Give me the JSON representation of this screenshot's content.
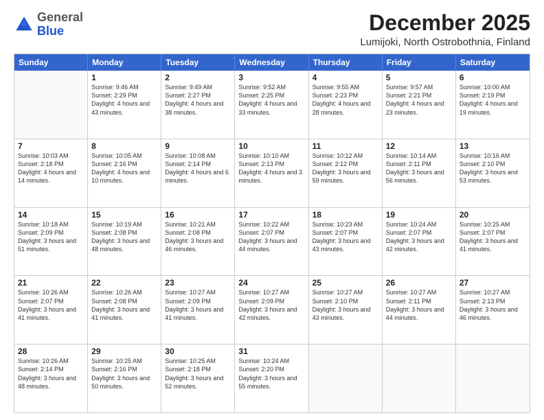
{
  "logo": {
    "general": "General",
    "blue": "Blue"
  },
  "header": {
    "title": "December 2025",
    "subtitle": "Lumijoki, North Ostrobothnia, Finland"
  },
  "weekdays": [
    "Sunday",
    "Monday",
    "Tuesday",
    "Wednesday",
    "Thursday",
    "Friday",
    "Saturday"
  ],
  "weeks": [
    [
      {
        "day": "",
        "sunrise": "",
        "sunset": "",
        "daylight": ""
      },
      {
        "day": "1",
        "sunrise": "Sunrise: 9:46 AM",
        "sunset": "Sunset: 2:29 PM",
        "daylight": "Daylight: 4 hours and 43 minutes."
      },
      {
        "day": "2",
        "sunrise": "Sunrise: 9:49 AM",
        "sunset": "Sunset: 2:27 PM",
        "daylight": "Daylight: 4 hours and 38 minutes."
      },
      {
        "day": "3",
        "sunrise": "Sunrise: 9:52 AM",
        "sunset": "Sunset: 2:25 PM",
        "daylight": "Daylight: 4 hours and 33 minutes."
      },
      {
        "day": "4",
        "sunrise": "Sunrise: 9:55 AM",
        "sunset": "Sunset: 2:23 PM",
        "daylight": "Daylight: 4 hours and 28 minutes."
      },
      {
        "day": "5",
        "sunrise": "Sunrise: 9:57 AM",
        "sunset": "Sunset: 2:21 PM",
        "daylight": "Daylight: 4 hours and 23 minutes."
      },
      {
        "day": "6",
        "sunrise": "Sunrise: 10:00 AM",
        "sunset": "Sunset: 2:19 PM",
        "daylight": "Daylight: 4 hours and 19 minutes."
      }
    ],
    [
      {
        "day": "7",
        "sunrise": "Sunrise: 10:03 AM",
        "sunset": "Sunset: 2:18 PM",
        "daylight": "Daylight: 4 hours and 14 minutes."
      },
      {
        "day": "8",
        "sunrise": "Sunrise: 10:05 AM",
        "sunset": "Sunset: 2:16 PM",
        "daylight": "Daylight: 4 hours and 10 minutes."
      },
      {
        "day": "9",
        "sunrise": "Sunrise: 10:08 AM",
        "sunset": "Sunset: 2:14 PM",
        "daylight": "Daylight: 4 hours and 6 minutes."
      },
      {
        "day": "10",
        "sunrise": "Sunrise: 10:10 AM",
        "sunset": "Sunset: 2:13 PM",
        "daylight": "Daylight: 4 hours and 3 minutes."
      },
      {
        "day": "11",
        "sunrise": "Sunrise: 10:12 AM",
        "sunset": "Sunset: 2:12 PM",
        "daylight": "Daylight: 3 hours and 59 minutes."
      },
      {
        "day": "12",
        "sunrise": "Sunrise: 10:14 AM",
        "sunset": "Sunset: 2:11 PM",
        "daylight": "Daylight: 3 hours and 56 minutes."
      },
      {
        "day": "13",
        "sunrise": "Sunrise: 10:16 AM",
        "sunset": "Sunset: 2:10 PM",
        "daylight": "Daylight: 3 hours and 53 minutes."
      }
    ],
    [
      {
        "day": "14",
        "sunrise": "Sunrise: 10:18 AM",
        "sunset": "Sunset: 2:09 PM",
        "daylight": "Daylight: 3 hours and 51 minutes."
      },
      {
        "day": "15",
        "sunrise": "Sunrise: 10:19 AM",
        "sunset": "Sunset: 2:08 PM",
        "daylight": "Daylight: 3 hours and 48 minutes."
      },
      {
        "day": "16",
        "sunrise": "Sunrise: 10:21 AM",
        "sunset": "Sunset: 2:08 PM",
        "daylight": "Daylight: 3 hours and 46 minutes."
      },
      {
        "day": "17",
        "sunrise": "Sunrise: 10:22 AM",
        "sunset": "Sunset: 2:07 PM",
        "daylight": "Daylight: 3 hours and 44 minutes."
      },
      {
        "day": "18",
        "sunrise": "Sunrise: 10:23 AM",
        "sunset": "Sunset: 2:07 PM",
        "daylight": "Daylight: 3 hours and 43 minutes."
      },
      {
        "day": "19",
        "sunrise": "Sunrise: 10:24 AM",
        "sunset": "Sunset: 2:07 PM",
        "daylight": "Daylight: 3 hours and 42 minutes."
      },
      {
        "day": "20",
        "sunrise": "Sunrise: 10:25 AM",
        "sunset": "Sunset: 2:07 PM",
        "daylight": "Daylight: 3 hours and 41 minutes."
      }
    ],
    [
      {
        "day": "21",
        "sunrise": "Sunrise: 10:26 AM",
        "sunset": "Sunset: 2:07 PM",
        "daylight": "Daylight: 3 hours and 41 minutes."
      },
      {
        "day": "22",
        "sunrise": "Sunrise: 10:26 AM",
        "sunset": "Sunset: 2:08 PM",
        "daylight": "Daylight: 3 hours and 41 minutes."
      },
      {
        "day": "23",
        "sunrise": "Sunrise: 10:27 AM",
        "sunset": "Sunset: 2:09 PM",
        "daylight": "Daylight: 3 hours and 41 minutes."
      },
      {
        "day": "24",
        "sunrise": "Sunrise: 10:27 AM",
        "sunset": "Sunset: 2:09 PM",
        "daylight": "Daylight: 3 hours and 42 minutes."
      },
      {
        "day": "25",
        "sunrise": "Sunrise: 10:27 AM",
        "sunset": "Sunset: 2:10 PM",
        "daylight": "Daylight: 3 hours and 43 minutes."
      },
      {
        "day": "26",
        "sunrise": "Sunrise: 10:27 AM",
        "sunset": "Sunset: 2:11 PM",
        "daylight": "Daylight: 3 hours and 44 minutes."
      },
      {
        "day": "27",
        "sunrise": "Sunrise: 10:27 AM",
        "sunset": "Sunset: 2:13 PM",
        "daylight": "Daylight: 3 hours and 46 minutes."
      }
    ],
    [
      {
        "day": "28",
        "sunrise": "Sunrise: 10:26 AM",
        "sunset": "Sunset: 2:14 PM",
        "daylight": "Daylight: 3 hours and 48 minutes."
      },
      {
        "day": "29",
        "sunrise": "Sunrise: 10:25 AM",
        "sunset": "Sunset: 2:16 PM",
        "daylight": "Daylight: 3 hours and 50 minutes."
      },
      {
        "day": "30",
        "sunrise": "Sunrise: 10:25 AM",
        "sunset": "Sunset: 2:18 PM",
        "daylight": "Daylight: 3 hours and 52 minutes."
      },
      {
        "day": "31",
        "sunrise": "Sunrise: 10:24 AM",
        "sunset": "Sunset: 2:20 PM",
        "daylight": "Daylight: 3 hours and 55 minutes."
      },
      {
        "day": "",
        "sunrise": "",
        "sunset": "",
        "daylight": ""
      },
      {
        "day": "",
        "sunrise": "",
        "sunset": "",
        "daylight": ""
      },
      {
        "day": "",
        "sunrise": "",
        "sunset": "",
        "daylight": ""
      }
    ]
  ]
}
